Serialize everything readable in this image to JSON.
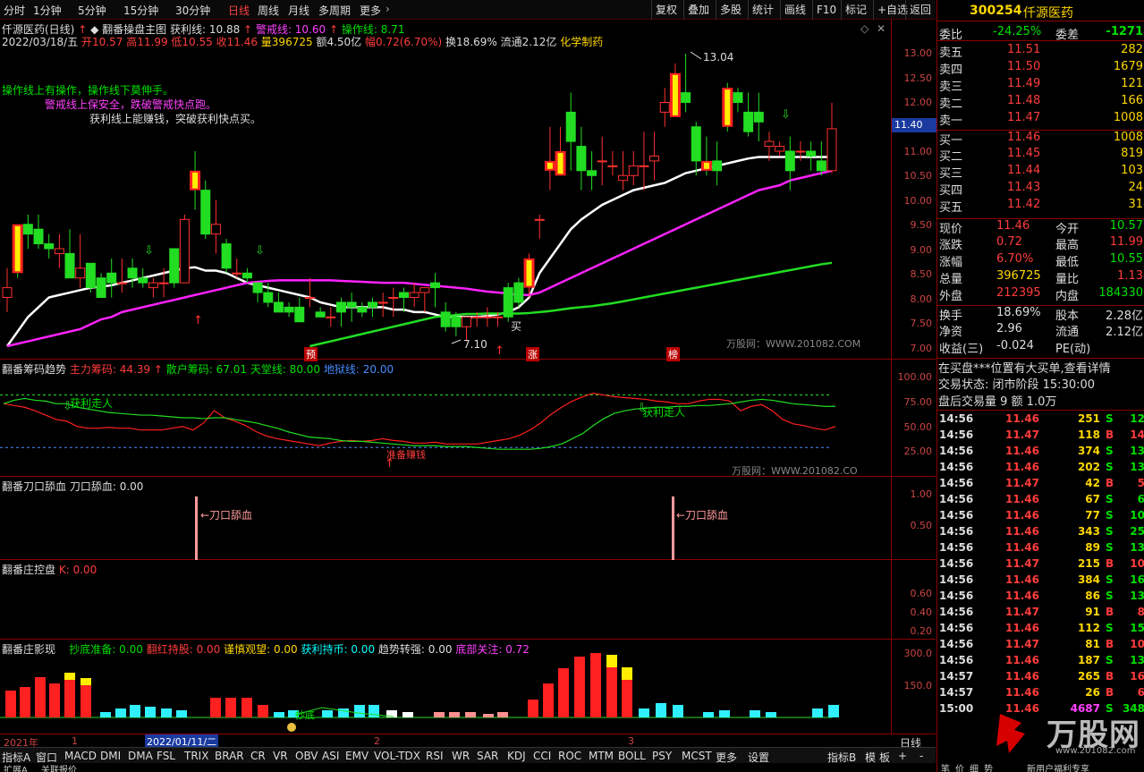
{
  "toolbar": {
    "left": [
      "分时",
      "1分钟",
      "5分钟",
      "15分钟",
      "30分钟",
      "日线",
      "周线",
      "月线",
      "多周期",
      "更多"
    ],
    "right": [
      "复权",
      "叠加",
      "多股",
      "统计",
      "画线",
      "F10",
      "标记",
      "+自选",
      "返回"
    ]
  },
  "main": {
    "title": "仟源医药(日线)",
    "indicator_name": "翻番操盘主图",
    "profit_line": "获利线: 10.88",
    "warn_line": "警戒线: 10.60",
    "op_line": "操作线: 8.71",
    "date": "2022/03/18/五",
    "open": "开10.57",
    "high": "高11.99",
    "low": "低10.55",
    "close": "收11.46",
    "volume": "量396725",
    "amount": "额4.50亿",
    "change": "幅0.72(6.70%)",
    "turnover": "换18.69%",
    "float": "流通2.12亿",
    "sector": "化学制药",
    "tips": [
      "操作线上有操作，操作线下莫伸手。",
      "警戒线上保安全，跌破警戒快点跑。",
      "获利线上能赚钱，突破获利快点买。"
    ],
    "max_label": "13.04",
    "min_label": "7.10",
    "buy_label": "买",
    "badges": [
      "预",
      "涨",
      "榜"
    ],
    "watermark": "万股网：WWW.201082.COM",
    "axis": [
      "13.00",
      "12.50",
      "12.00",
      "11.50",
      "11.00",
      "10.50",
      "10.00",
      "9.50",
      "9.00",
      "8.50",
      "8.00",
      "7.50",
      "7.00"
    ],
    "price_tag": "11.40"
  },
  "p2": {
    "name": "翻番筹码趋势",
    "main": "主力筹码: 44.39",
    "retail": "散户筹码: 67.01",
    "sky": "天堂线: 80.00",
    "ground": "地狱线: 20.00",
    "axis": [
      "100.00",
      "75.00",
      "50.00",
      "25.00"
    ],
    "tag1": "获利走人",
    "tag2": "获利走人",
    "tag3": "准备赚钱",
    "watermark": "万股网：WWW.201082.CO"
  },
  "p3": {
    "name": "翻番刀口舔血",
    "value": "刀口舔血: 0.00",
    "label1": "←刀口舔血",
    "label2": "←刀口舔血",
    "axis": [
      "1.00",
      "0.50"
    ]
  },
  "p4": {
    "name": "翻番庄控盘",
    "value": "K: 0.00",
    "axis": [
      "0.60",
      "0.40",
      "0.20"
    ]
  },
  "p5": {
    "name": "翻番庄影现",
    "items": [
      "抄底准备: 0.00",
      "翻红持股: 0.00",
      "谨慎观望: 0.00",
      "获利持币: 0.00",
      "趋势转强: 0.00",
      "底部关注: 0.72"
    ],
    "axis": [
      "300.0",
      "150.0"
    ],
    "label": "抄底"
  },
  "timeline": {
    "year": "2021年",
    "m1": "1",
    "date": "2022/01/11/二",
    "m2": "2",
    "m3": "3",
    "tag": "日线"
  },
  "bottombar": [
    "指标A",
    "窗口",
    "MACD",
    "DMI",
    "DMA",
    "FSL",
    "TRIX",
    "BRAR",
    "CR",
    "VR",
    "OBV",
    "ASI",
    "EMV",
    "VOL-TDX",
    "RSI",
    "WR",
    "SAR",
    "KDJ",
    "CCI",
    "ROC",
    "MTM",
    "BOLL",
    "PSY",
    "MCST",
    "更多",
    "设置"
  ],
  "bottom_right": [
    "指标B",
    "模",
    "板"
  ],
  "bottom_line2": [
    "扩展A",
    "关联报价"
  ],
  "quote": {
    "code": "300254",
    "name": "仟源医药",
    "weibi_label": "委比",
    "weibi": "-24.25%",
    "weicha_label": "委差",
    "weicha": "-1271",
    "sells": [
      [
        "卖五",
        "11.51",
        "282"
      ],
      [
        "卖四",
        "11.50",
        "1679"
      ],
      [
        "卖三",
        "11.49",
        "121"
      ],
      [
        "卖二",
        "11.48",
        "166"
      ],
      [
        "卖一",
        "11.47",
        "1008"
      ]
    ],
    "buys": [
      [
        "买一",
        "11.46",
        "1008"
      ],
      [
        "买二",
        "11.45",
        "819"
      ],
      [
        "买三",
        "11.44",
        "103"
      ],
      [
        "买四",
        "11.43",
        "24"
      ],
      [
        "买五",
        "11.42",
        "31"
      ]
    ],
    "stats": [
      [
        "现价",
        "11.46",
        "今开",
        "10.57"
      ],
      [
        "涨跌",
        "0.72",
        "最高",
        "11.99"
      ],
      [
        "涨幅",
        "6.70%",
        "最低",
        "10.55"
      ],
      [
        "总量",
        "396725",
        "量比",
        "1.13"
      ],
      [
        "外盘",
        "212395",
        "内盘",
        "184330"
      ]
    ],
    "stats2": [
      [
        "换手",
        "18.69%",
        "股本",
        "2.28亿"
      ],
      [
        "净资",
        "2.96",
        "流通",
        "2.12亿"
      ],
      [
        "收益(三)",
        "-0.024",
        "PE(动)",
        ""
      ]
    ],
    "notice1": "在买盘***位置有大买单,查看详情",
    "notice2": "交易状态: 闭市阶段 15:30:00",
    "notice3": "盘后交易量 9 额 1.0万",
    "ticks": [
      [
        "14:56",
        "11.46",
        "251",
        "S",
        "12"
      ],
      [
        "14:56",
        "11.47",
        "118",
        "B",
        "14"
      ],
      [
        "14:56",
        "11.46",
        "374",
        "S",
        "13"
      ],
      [
        "14:56",
        "11.46",
        "202",
        "S",
        "13"
      ],
      [
        "14:56",
        "11.47",
        "42",
        "B",
        "5"
      ],
      [
        "14:56",
        "11.46",
        "67",
        "S",
        "6"
      ],
      [
        "14:56",
        "11.46",
        "77",
        "S",
        "10"
      ],
      [
        "14:56",
        "11.46",
        "343",
        "S",
        "25"
      ],
      [
        "14:56",
        "11.46",
        "89",
        "S",
        "13"
      ],
      [
        "14:56",
        "11.47",
        "215",
        "B",
        "10"
      ],
      [
        "14:56",
        "11.46",
        "384",
        "S",
        "16"
      ],
      [
        "14:56",
        "11.46",
        "86",
        "S",
        "13"
      ],
      [
        "14:56",
        "11.47",
        "91",
        "B",
        "8"
      ],
      [
        "14:56",
        "11.46",
        "112",
        "S",
        "15"
      ],
      [
        "14:56",
        "11.47",
        "81",
        "B",
        "10"
      ],
      [
        "14:56",
        "11.46",
        "187",
        "S",
        "13"
      ],
      [
        "14:57",
        "11.46",
        "265",
        "B",
        "16"
      ],
      [
        "14:57",
        "11.46",
        "26",
        "B",
        "6"
      ],
      [
        "15:00",
        "11.46",
        "4687",
        "S",
        "348"
      ]
    ],
    "brand": "万股网",
    "brand_url": "www.201082.com",
    "foot": "新用户福利专享"
  },
  "chart_data": {
    "type": "candlestick",
    "candles": [
      [
        8.0,
        8.6,
        7.7,
        8.2
      ],
      [
        9.5,
        9.5,
        8.4,
        8.5
      ],
      [
        9.5,
        9.7,
        9.0,
        9.3
      ],
      [
        9.4,
        9.7,
        9.0,
        9.1
      ],
      [
        9.1,
        9.3,
        8.8,
        9.0
      ],
      [
        8.9,
        9.3,
        8.6,
        9.0
      ],
      [
        8.9,
        9.4,
        8.4,
        8.4
      ],
      [
        8.4,
        9.3,
        8.2,
        8.6
      ],
      [
        8.7,
        8.7,
        8.1,
        8.2
      ],
      [
        8.4,
        8.5,
        8.0,
        8.0
      ],
      [
        8.5,
        8.8,
        8.0,
        8.3
      ],
      [
        8.3,
        8.8,
        8.1,
        8.3
      ],
      [
        8.6,
        8.8,
        8.2,
        8.4
      ],
      [
        8.4,
        8.6,
        8.2,
        8.3
      ],
      [
        8.2,
        8.4,
        8.0,
        8.3
      ],
      [
        8.3,
        8.6,
        8.0,
        8.3
      ],
      [
        9.0,
        9.0,
        8.2,
        8.3
      ],
      [
        8.3,
        9.7,
        8.3,
        9.6
      ],
      [
        10.6,
        11.0,
        9.8,
        10.2
      ],
      [
        10.2,
        10.4,
        9.2,
        9.3
      ],
      [
        9.3,
        10.0,
        8.9,
        9.5
      ],
      [
        9.1,
        9.2,
        8.5,
        8.6
      ],
      [
        8.5,
        8.8,
        8.4,
        8.5
      ],
      [
        8.5,
        8.6,
        8.3,
        8.4
      ],
      [
        8.3,
        8.3,
        7.9,
        8.1
      ],
      [
        8.1,
        8.3,
        7.8,
        7.9
      ],
      [
        7.9,
        8.1,
        7.7,
        7.7
      ],
      [
        7.8,
        7.9,
        7.6,
        7.7
      ],
      [
        7.8,
        8.0,
        7.5,
        7.5
      ],
      [
        8.0,
        8.4,
        7.8,
        8.0
      ],
      [
        7.7,
        7.8,
        7.6,
        7.6
      ],
      [
        7.6,
        7.8,
        7.4,
        7.6
      ],
      [
        7.9,
        8.0,
        7.4,
        7.7
      ],
      [
        7.9,
        8.1,
        7.5,
        7.8
      ],
      [
        7.8,
        7.9,
        7.6,
        7.7
      ],
      [
        7.9,
        8.0,
        7.6,
        7.8
      ],
      [
        7.9,
        8.1,
        7.6,
        7.9
      ],
      [
        8.0,
        8.2,
        7.6,
        8.0
      ],
      [
        8.1,
        8.2,
        7.7,
        8.0
      ],
      [
        8.0,
        8.3,
        7.8,
        8.1
      ],
      [
        8.1,
        8.2,
        7.7,
        8.2
      ],
      [
        8.3,
        8.5,
        7.8,
        8.2
      ],
      [
        7.7,
        7.9,
        7.3,
        7.4
      ],
      [
        7.6,
        7.7,
        7.2,
        7.4
      ],
      [
        7.4,
        7.6,
        7.1,
        7.6
      ],
      [
        7.6,
        7.7,
        7.4,
        7.6
      ],
      [
        7.6,
        7.8,
        7.4,
        7.6
      ],
      [
        7.6,
        7.7,
        7.4,
        7.6
      ],
      [
        8.2,
        8.3,
        7.5,
        7.6
      ],
      [
        8.3,
        8.4,
        7.8,
        7.9
      ],
      [
        8.2,
        8.9,
        8.0,
        8.8
      ],
      [
        9.6,
        9.7,
        9.2,
        9.6
      ],
      [
        10.6,
        11.5,
        10.2,
        10.8
      ],
      [
        10.5,
        11.5,
        10.5,
        11.0
      ],
      [
        11.8,
        12.2,
        10.6,
        11.2
      ],
      [
        11.1,
        11.5,
        10.2,
        10.6
      ],
      [
        10.6,
        11.0,
        10.2,
        10.5
      ],
      [
        10.8,
        11.3,
        10.3,
        10.8
      ],
      [
        10.7,
        11.0,
        10.5,
        10.7
      ],
      [
        10.4,
        11.0,
        10.2,
        10.5
      ],
      [
        10.5,
        11.0,
        10.3,
        10.7
      ],
      [
        10.7,
        11.4,
        10.2,
        10.7
      ],
      [
        10.8,
        11.4,
        10.4,
        10.9
      ],
      [
        11.8,
        12.3,
        11.5,
        12.0
      ],
      [
        11.7,
        12.8,
        11.7,
        12.6
      ],
      [
        12.2,
        13.0,
        11.8,
        12.0
      ],
      [
        11.5,
        11.6,
        10.5,
        10.8
      ],
      [
        10.8,
        11.3,
        10.5,
        10.6
      ],
      [
        10.8,
        11.2,
        10.3,
        10.6
      ],
      [
        12.3,
        12.4,
        11.4,
        11.5
      ],
      [
        12.2,
        12.3,
        11.8,
        12.0
      ],
      [
        11.8,
        12.2,
        11.3,
        11.4
      ],
      [
        11.8,
        12.2,
        11.2,
        11.6
      ],
      [
        11.1,
        11.4,
        10.8,
        11.2
      ],
      [
        11.0,
        11.2,
        10.9,
        11.1
      ],
      [
        11.0,
        11.3,
        10.2,
        10.6
      ],
      [
        11.0,
        11.2,
        10.8,
        11.0
      ],
      [
        11.0,
        11.2,
        10.6,
        10.9
      ],
      [
        10.8,
        11.2,
        10.5,
        10.6
      ],
      [
        10.6,
        11.99,
        10.55,
        11.46
      ]
    ],
    "ma_white": [
      7.0,
      7.3,
      7.6,
      7.8,
      8.0,
      8.05,
      8.1,
      8.15,
      8.2,
      8.22,
      8.25,
      8.3,
      8.35,
      8.4,
      8.45,
      8.5,
      8.55,
      8.6,
      8.62,
      8.55,
      8.55,
      8.5,
      8.4,
      8.3,
      8.25,
      8.2,
      8.15,
      8.1,
      8.05,
      8.0,
      7.9,
      7.85,
      7.8,
      7.8,
      7.8,
      7.8,
      7.8,
      7.75,
      7.75,
      7.7,
      7.7,
      7.65,
      7.6,
      7.6,
      7.6,
      7.6,
      7.62,
      7.65,
      7.7,
      7.8,
      8.0,
      8.5,
      8.8,
      9.1,
      9.4,
      9.6,
      9.75,
      9.9,
      10.0,
      10.1,
      10.2,
      10.25,
      10.3,
      10.35,
      10.45,
      10.55,
      10.6,
      10.65,
      10.7,
      10.75,
      10.8,
      10.85,
      10.88,
      10.88,
      10.88,
      10.88,
      10.88,
      10.88,
      10.88,
      10.88
    ],
    "ma_magenta": [
      7.0,
      7.05,
      7.1,
      7.15,
      7.2,
      7.25,
      7.3,
      7.35,
      7.45,
      7.55,
      7.6,
      7.7,
      7.75,
      7.8,
      7.85,
      7.9,
      7.95,
      8.0,
      8.05,
      8.1,
      8.15,
      8.2,
      8.25,
      8.3,
      8.32,
      8.34,
      8.35,
      8.35,
      8.35,
      8.35,
      8.35,
      8.35,
      8.34,
      8.33,
      8.32,
      8.31,
      8.3,
      8.3,
      8.3,
      8.28,
      8.26,
      8.24,
      8.22,
      8.2,
      8.18,
      8.15,
      8.12,
      8.1,
      8.08,
      8.05,
      8.05,
      8.1,
      8.2,
      8.3,
      8.4,
      8.5,
      8.6,
      8.7,
      8.8,
      8.9,
      9.0,
      9.1,
      9.2,
      9.3,
      9.4,
      9.5,
      9.6,
      9.7,
      9.8,
      9.9,
      10.0,
      10.1,
      10.2,
      10.25,
      10.3,
      10.4,
      10.45,
      10.5,
      10.55,
      10.6
    ],
    "ma_green": [
      7.0,
      7.05,
      7.1,
      7.15,
      7.2,
      7.25,
      7.3,
      7.35,
      7.4,
      7.45,
      7.5,
      7.55,
      7.6,
      7.62,
      7.64,
      7.66,
      7.66,
      7.67,
      7.67,
      7.67,
      7.67,
      7.68,
      7.7,
      7.72,
      7.75,
      7.78,
      7.8,
      7.82,
      7.85,
      7.88,
      7.92,
      7.96,
      8.0,
      8.04,
      8.08,
      8.12,
      8.16,
      8.2,
      8.24,
      8.28,
      8.32,
      8.36,
      8.4,
      8.44,
      8.48,
      8.52,
      8.56,
      8.6,
      8.64,
      8.68,
      8.71
    ]
  }
}
